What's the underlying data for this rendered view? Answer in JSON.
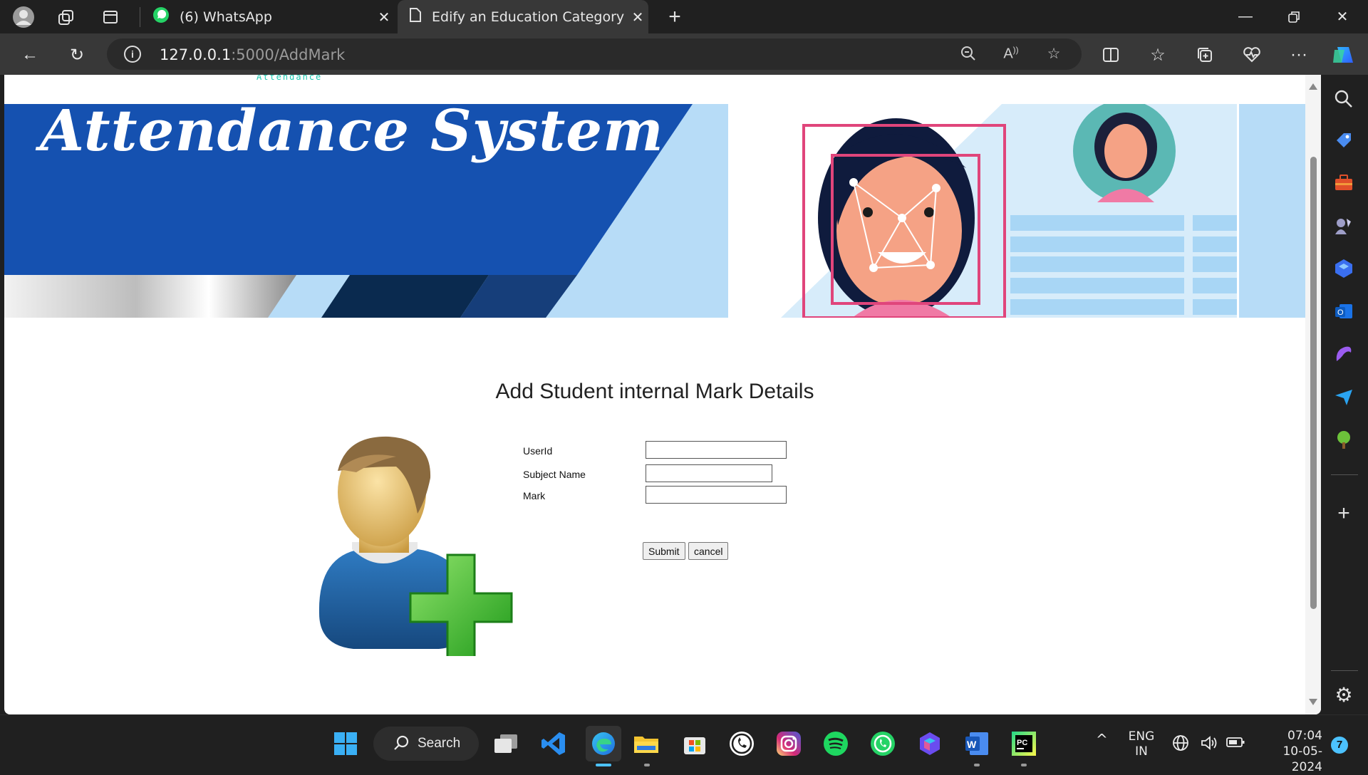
{
  "browser": {
    "tabs": [
      {
        "title": "(6) WhatsApp",
        "active": false
      },
      {
        "title": "Edify an Education Category Boo",
        "active": true
      }
    ],
    "address": {
      "host": "127.0.0.1",
      "path": ":5000/AddMark"
    }
  },
  "page": {
    "top_tiny_text": "Attendance",
    "banner_title": "Attendance System",
    "heading": "Add Student internal Mark Details",
    "form": {
      "fields": [
        {
          "label": "UserId",
          "value": ""
        },
        {
          "label": "Subject Name",
          "value": ""
        },
        {
          "label": "Mark",
          "value": ""
        }
      ],
      "submit_label": "Submit",
      "cancel_label": "cancel"
    }
  },
  "taskbar": {
    "search_label": "Search",
    "lang_line1": "ENG",
    "lang_line2": "IN",
    "time": "07:04",
    "date": "10-05-2024",
    "notification_count": "7"
  },
  "colors": {
    "banner_blue": "#1551b0",
    "banner_light": "#b7dcf7",
    "frame_pink": "#e0457b"
  }
}
